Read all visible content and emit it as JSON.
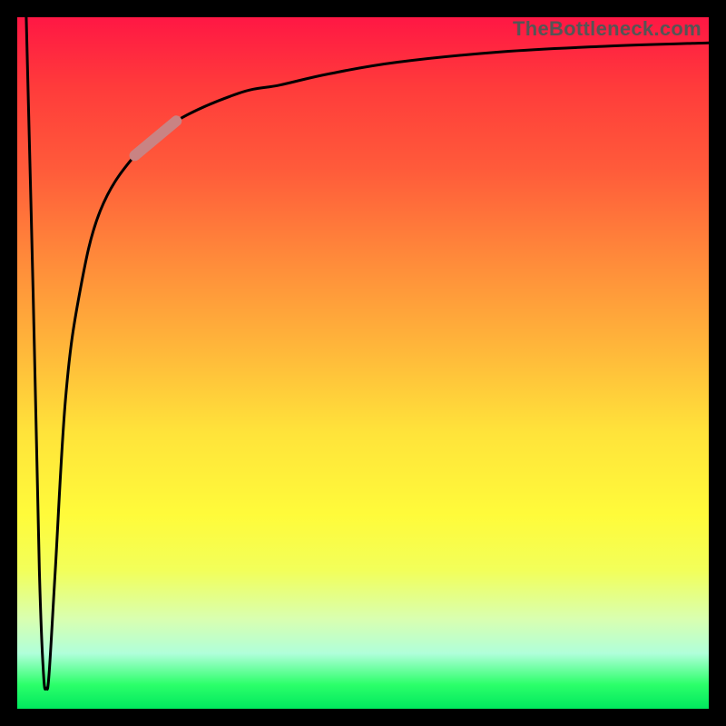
{
  "watermark": "TheBottleneck.com",
  "chart_data": {
    "type": "line",
    "title": "",
    "xlabel": "",
    "ylabel": "",
    "xlim": [
      0,
      100
    ],
    "ylim": [
      0,
      100
    ],
    "series": [
      {
        "name": "bottleneck-curve",
        "points": [
          {
            "x": 1.3,
            "y": 100
          },
          {
            "x": 2.3,
            "y": 60
          },
          {
            "x": 3.2,
            "y": 20
          },
          {
            "x": 3.8,
            "y": 5
          },
          {
            "x": 4.2,
            "y": 3
          },
          {
            "x": 4.6,
            "y": 5
          },
          {
            "x": 5.5,
            "y": 20
          },
          {
            "x": 7,
            "y": 45
          },
          {
            "x": 9,
            "y": 60
          },
          {
            "x": 12,
            "y": 72
          },
          {
            "x": 17,
            "y": 80
          },
          {
            "x": 23,
            "y": 85
          },
          {
            "x": 32,
            "y": 89
          },
          {
            "x": 38,
            "y": 90.2
          },
          {
            "x": 45,
            "y": 91.8
          },
          {
            "x": 55,
            "y": 93.5
          },
          {
            "x": 70,
            "y": 95
          },
          {
            "x": 85,
            "y": 95.8
          },
          {
            "x": 100,
            "y": 96.3
          }
        ]
      },
      {
        "name": "highlighted-segment",
        "points": [
          {
            "x": 17,
            "y": 80
          },
          {
            "x": 23,
            "y": 85
          }
        ],
        "color": "#c98383",
        "weight": 12
      }
    ]
  }
}
